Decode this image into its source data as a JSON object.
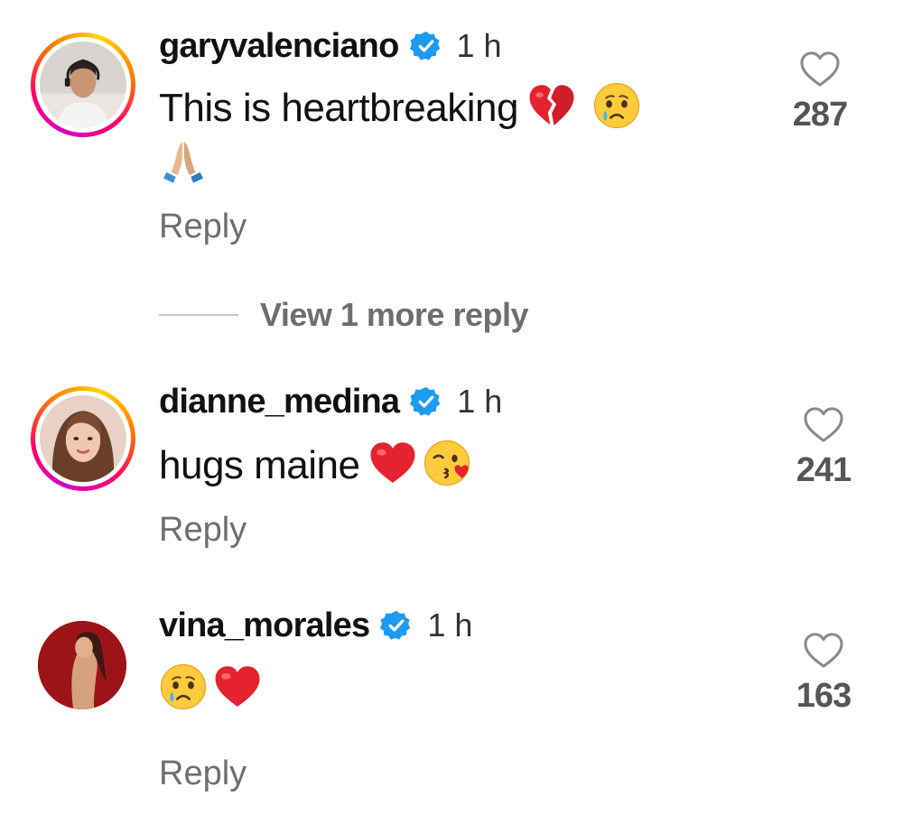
{
  "comments": [
    {
      "username": "garyvalenciano",
      "time": "1 h",
      "text": "This is heartbreaking",
      "emojis": [
        "broken-heart",
        "crying-face",
        "folded-hands"
      ],
      "likes": "287",
      "reply_label": "Reply"
    },
    {
      "username": "dianne_medina",
      "time": "1 h",
      "text": "hugs maine",
      "emojis": [
        "red-heart",
        "face-blowing-kiss"
      ],
      "likes": "241",
      "reply_label": "Reply"
    },
    {
      "username": "vina_morales",
      "time": "1 h",
      "text": "",
      "emojis": [
        "crying-face",
        "red-heart"
      ],
      "likes": "163",
      "reply_label": "Reply"
    }
  ],
  "view_more_label": "View 1 more reply",
  "colors": {
    "verified": "#1d9bf0",
    "secondary_text": "#6e6e6e",
    "primary_text": "#111111"
  }
}
